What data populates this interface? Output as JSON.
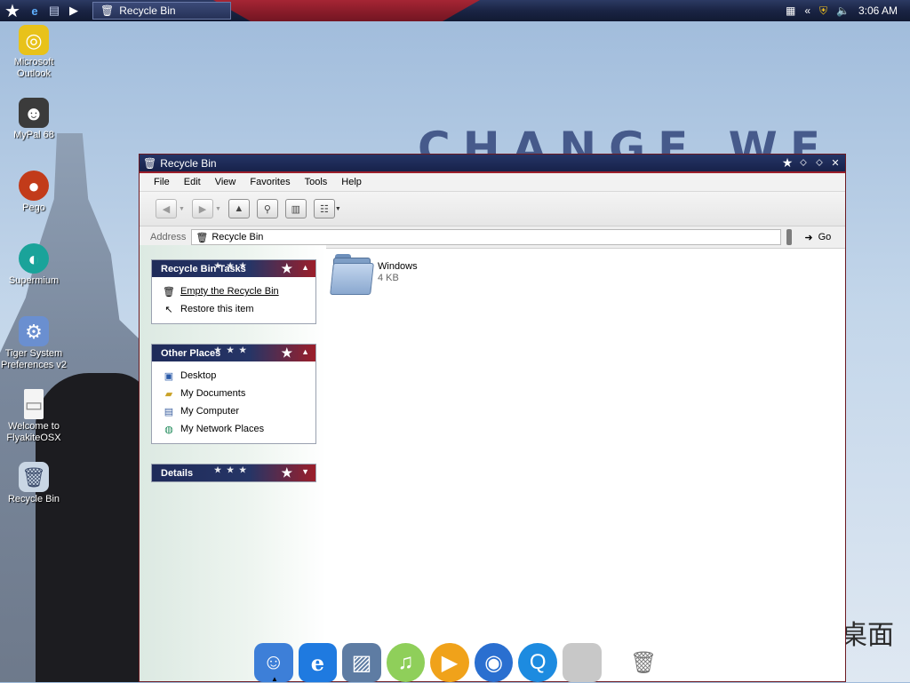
{
  "taskbar": {
    "task_label": "Recycle Bin",
    "clock": "3:06 AM",
    "tray_chevron": "«"
  },
  "desktop": {
    "slogan": "CHANGE WE NEED",
    "corner_logo": "桌面",
    "icons": [
      {
        "label": "Microsoft Outlook",
        "icon": "outlook-icon",
        "color": "#e8c21a"
      },
      {
        "label": "MyPal 68",
        "icon": "mypal-icon",
        "color": "#3b3b3b"
      },
      {
        "label": "Pego",
        "icon": "pego-icon",
        "color": "#c23b1a"
      },
      {
        "label": "Supermium",
        "icon": "supermium-icon",
        "color": "#1aa39a"
      },
      {
        "label": "Tiger System Preferences v2",
        "icon": "system-preferences-icon",
        "color": "#6a8fd0"
      },
      {
        "label": "Welcome to FlyakiteOSX",
        "icon": "document-icon",
        "color": "#f4f4f4"
      },
      {
        "label": "Recycle Bin",
        "icon": "recycle-bin-icon",
        "color": "#c9d6e4"
      }
    ]
  },
  "window": {
    "title": "Recycle Bin",
    "menu": [
      "File",
      "Edit",
      "View",
      "Favorites",
      "Tools",
      "Help"
    ],
    "address_label": "Address",
    "address_value": "Recycle Bin",
    "go_label": "Go",
    "panels": {
      "tasks": {
        "title": "Recycle Bin Tasks",
        "items": [
          {
            "label": "Empty the Recycle Bin",
            "icon": "recycle-bin-icon"
          },
          {
            "label": "Restore this item",
            "icon": "restore-icon"
          }
        ]
      },
      "places": {
        "title": "Other Places",
        "items": [
          {
            "label": "Desktop",
            "icon": "desktop-icon"
          },
          {
            "label": "My Documents",
            "icon": "my-documents-icon"
          },
          {
            "label": "My Computer",
            "icon": "my-computer-icon"
          },
          {
            "label": "My Network Places",
            "icon": "network-places-icon"
          }
        ]
      },
      "details": {
        "title": "Details"
      }
    },
    "files": [
      {
        "name": "Windows",
        "size": "4 KB",
        "icon": "folder-icon"
      }
    ]
  },
  "dock": {
    "items": [
      {
        "name": "finder-icon",
        "color": "#3d7fd8"
      },
      {
        "name": "internet-explorer-icon",
        "color": "#1f7ae0"
      },
      {
        "name": "photo-app-icon",
        "color": "#5e7ca3"
      },
      {
        "name": "itunes-icon",
        "color": "#8fcf5a"
      },
      {
        "name": "media-player-icon",
        "color": "#f0a21a"
      },
      {
        "name": "media-center-icon",
        "color": "#2a6fd0"
      },
      {
        "name": "quicktime-icon",
        "color": "#1d8be0"
      },
      {
        "name": "system-preferences-dock-icon",
        "color": "#c8c8c8"
      },
      {
        "name": "trash-icon",
        "color": "#aaaaaa"
      }
    ]
  }
}
